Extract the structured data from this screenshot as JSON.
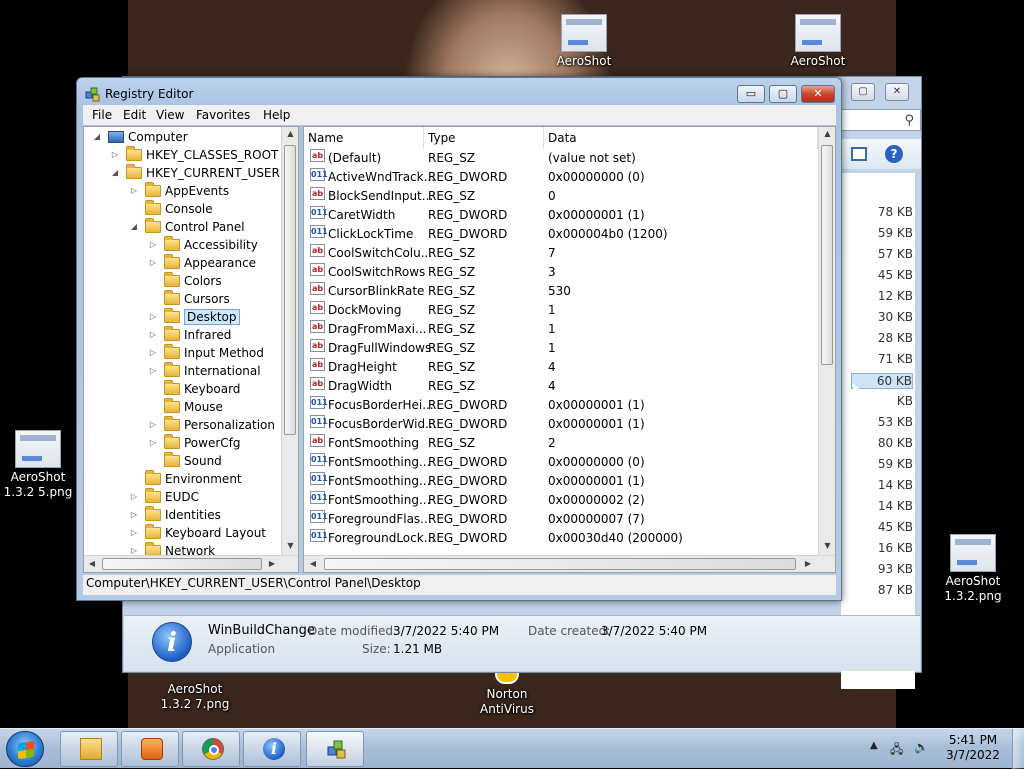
{
  "desktop": {
    "icons": [
      {
        "label": "AeroShot"
      },
      {
        "label": "AeroShot"
      },
      {
        "label": "AeroShot 1.3.2 5.png"
      },
      {
        "label": "AeroShot 1.3.2.png"
      },
      {
        "label": "AeroShot 1.3.2 7.png"
      },
      {
        "label": "Norton AntiVirus"
      }
    ]
  },
  "explorer": {
    "sizes": [
      "78 KB",
      "59 KB",
      "57 KB",
      "45 KB",
      "12 KB",
      "30 KB",
      "28 KB",
      "71 KB",
      "60 KB",
      "KB",
      "53 KB",
      "80 KB",
      "59 KB",
      "14 KB",
      "14 KB",
      "45 KB",
      "16 KB",
      "93 KB",
      "87 KB"
    ],
    "details": {
      "name": "WinBuildChange",
      "type": "Application",
      "modified_label": "Date modified:",
      "modified_value": "3/7/2022 5:40 PM",
      "created_label": "Date created:",
      "created_value": "3/7/2022 5:40 PM",
      "size_label": "Size:",
      "size_value": "1.21 MB"
    }
  },
  "regedit": {
    "title": "Registry Editor",
    "window_controls": {
      "minimize": "▭",
      "maximize": "▢",
      "close": "✕"
    },
    "menu": [
      "File",
      "Edit",
      "View",
      "Favorites",
      "Help"
    ],
    "tree": [
      {
        "label": "Computer",
        "level": 0,
        "icon": "computer-icon",
        "expander": "◢"
      },
      {
        "label": "HKEY_CLASSES_ROOT",
        "level": 1,
        "icon": "folder-icon",
        "expander": "▷"
      },
      {
        "label": "HKEY_CURRENT_USER",
        "level": 1,
        "icon": "folder-icon",
        "expander": "◢"
      },
      {
        "label": "AppEvents",
        "level": 2,
        "icon": "folder-icon",
        "expander": "▷"
      },
      {
        "label": "Console",
        "level": 2,
        "icon": "folder-icon",
        "expander": ""
      },
      {
        "label": "Control Panel",
        "level": 2,
        "icon": "folder-icon",
        "expander": "◢"
      },
      {
        "label": "Accessibility",
        "level": 3,
        "icon": "folder-icon",
        "expander": "▷"
      },
      {
        "label": "Appearance",
        "level": 3,
        "icon": "folder-icon",
        "expander": "▷"
      },
      {
        "label": "Colors",
        "level": 3,
        "icon": "folder-icon",
        "expander": ""
      },
      {
        "label": "Cursors",
        "level": 3,
        "icon": "folder-icon",
        "expander": ""
      },
      {
        "label": "Desktop",
        "level": 3,
        "icon": "folder-icon",
        "expander": "▷",
        "selected": true
      },
      {
        "label": "Infrared",
        "level": 3,
        "icon": "folder-icon",
        "expander": "▷"
      },
      {
        "label": "Input Method",
        "level": 3,
        "icon": "folder-icon",
        "expander": "▷"
      },
      {
        "label": "International",
        "level": 3,
        "icon": "folder-icon",
        "expander": "▷"
      },
      {
        "label": "Keyboard",
        "level": 3,
        "icon": "folder-icon",
        "expander": ""
      },
      {
        "label": "Mouse",
        "level": 3,
        "icon": "folder-icon",
        "expander": ""
      },
      {
        "label": "Personalization",
        "level": 3,
        "icon": "folder-icon",
        "expander": "▷"
      },
      {
        "label": "PowerCfg",
        "level": 3,
        "icon": "folder-icon",
        "expander": "▷"
      },
      {
        "label": "Sound",
        "level": 3,
        "icon": "folder-icon",
        "expander": ""
      },
      {
        "label": "Environment",
        "level": 2,
        "icon": "folder-icon",
        "expander": ""
      },
      {
        "label": "EUDC",
        "level": 2,
        "icon": "folder-icon",
        "expander": "▷"
      },
      {
        "label": "Identities",
        "level": 2,
        "icon": "folder-icon",
        "expander": "▷"
      },
      {
        "label": "Keyboard Layout",
        "level": 2,
        "icon": "folder-icon",
        "expander": "▷"
      },
      {
        "label": "Network",
        "level": 2,
        "icon": "folder-icon",
        "expander": "▷"
      }
    ],
    "columns": [
      "Name",
      "Type",
      "Data"
    ],
    "values": [
      {
        "name": "(Default)",
        "type": "REG_SZ",
        "data": "(value not set)",
        "kind": "sz"
      },
      {
        "name": "ActiveWndTrack...",
        "type": "REG_DWORD",
        "data": "0x00000000 (0)",
        "kind": "dw"
      },
      {
        "name": "BlockSendInput...",
        "type": "REG_SZ",
        "data": "0",
        "kind": "sz"
      },
      {
        "name": "CaretWidth",
        "type": "REG_DWORD",
        "data": "0x00000001 (1)",
        "kind": "dw"
      },
      {
        "name": "ClickLockTime",
        "type": "REG_DWORD",
        "data": "0x000004b0 (1200)",
        "kind": "dw"
      },
      {
        "name": "CoolSwitchColu...",
        "type": "REG_SZ",
        "data": "7",
        "kind": "sz"
      },
      {
        "name": "CoolSwitchRows",
        "type": "REG_SZ",
        "data": "3",
        "kind": "sz"
      },
      {
        "name": "CursorBlinkRate",
        "type": "REG_SZ",
        "data": "530",
        "kind": "sz"
      },
      {
        "name": "DockMoving",
        "type": "REG_SZ",
        "data": "1",
        "kind": "sz"
      },
      {
        "name": "DragFromMaxi...",
        "type": "REG_SZ",
        "data": "1",
        "kind": "sz"
      },
      {
        "name": "DragFullWindows",
        "type": "REG_SZ",
        "data": "1",
        "kind": "sz"
      },
      {
        "name": "DragHeight",
        "type": "REG_SZ",
        "data": "4",
        "kind": "sz"
      },
      {
        "name": "DragWidth",
        "type": "REG_SZ",
        "data": "4",
        "kind": "sz"
      },
      {
        "name": "FocusBorderHei...",
        "type": "REG_DWORD",
        "data": "0x00000001 (1)",
        "kind": "dw"
      },
      {
        "name": "FocusBorderWid...",
        "type": "REG_DWORD",
        "data": "0x00000001 (1)",
        "kind": "dw"
      },
      {
        "name": "FontSmoothing",
        "type": "REG_SZ",
        "data": "2",
        "kind": "sz"
      },
      {
        "name": "FontSmoothing...",
        "type": "REG_DWORD",
        "data": "0x00000000 (0)",
        "kind": "dw"
      },
      {
        "name": "FontSmoothing...",
        "type": "REG_DWORD",
        "data": "0x00000001 (1)",
        "kind": "dw"
      },
      {
        "name": "FontSmoothing...",
        "type": "REG_DWORD",
        "data": "0x00000002 (2)",
        "kind": "dw"
      },
      {
        "name": "ForegroundFlas...",
        "type": "REG_DWORD",
        "data": "0x00000007 (7)",
        "kind": "dw"
      },
      {
        "name": "ForegroundLock...",
        "type": "REG_DWORD",
        "data": "0x00030d40 (200000)",
        "kind": "dw"
      }
    ],
    "value_icon_text": {
      "sz": "ab",
      "dw": "011"
    },
    "status": "Computer\\HKEY_CURRENT_USER\\Control Panel\\Desktop"
  },
  "taskbar": {
    "apps": [
      {
        "icon": "folder-explorer-icon"
      },
      {
        "icon": "media-player-icon"
      },
      {
        "icon": "chrome-icon"
      },
      {
        "icon": "info-app-icon"
      },
      {
        "icon": "regedit-icon"
      }
    ],
    "tray_icons": [
      "show-hidden-icons-chevron",
      "network-icon",
      "volume-icon"
    ],
    "clock_time": "5:41 PM",
    "clock_date": "3/7/2022"
  },
  "colors": {
    "selection": "#cce8ff",
    "window_frame": "#a9c3e2",
    "close_button": "#c8452c"
  }
}
